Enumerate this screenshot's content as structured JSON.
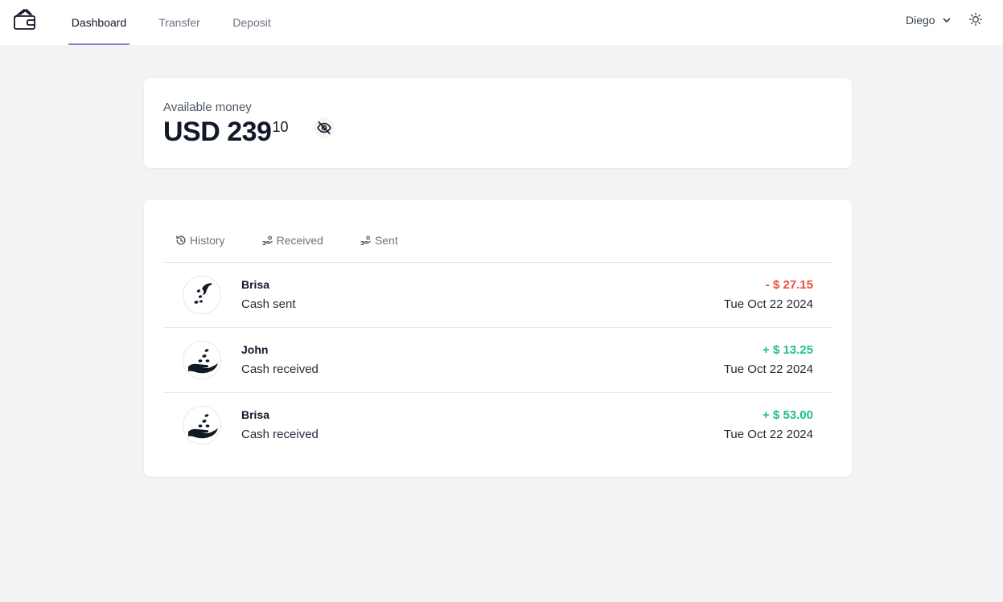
{
  "nav": {
    "tabs": [
      {
        "label": "Dashboard",
        "active": true
      },
      {
        "label": "Transfer",
        "active": false
      },
      {
        "label": "Deposit",
        "active": false
      }
    ],
    "user_name": "Diego",
    "accent_color": "#8b7fd6"
  },
  "balance": {
    "label": "Available money",
    "currency_amount": "USD 239",
    "cents": "10"
  },
  "filters": [
    {
      "label": "History",
      "icon": "history-icon"
    },
    {
      "label": "Received",
      "icon": "hand-coin-icon"
    },
    {
      "label": "Sent",
      "icon": "hand-coin-icon"
    }
  ],
  "transactions": [
    {
      "name": "Brisa",
      "description": "Cash sent",
      "amount": "- $ 27.15",
      "date": "Tue Oct 22 2024",
      "direction": "sent"
    },
    {
      "name": "John",
      "description": "Cash received",
      "amount": "+ $ 13.25",
      "date": "Tue Oct 22 2024",
      "direction": "received"
    },
    {
      "name": "Brisa",
      "description": "Cash received",
      "amount": "+ $ 53.00",
      "date": "Tue Oct 22 2024",
      "direction": "received"
    }
  ],
  "colors": {
    "negative": "#ef4b3c",
    "positive": "#1fbe84"
  }
}
